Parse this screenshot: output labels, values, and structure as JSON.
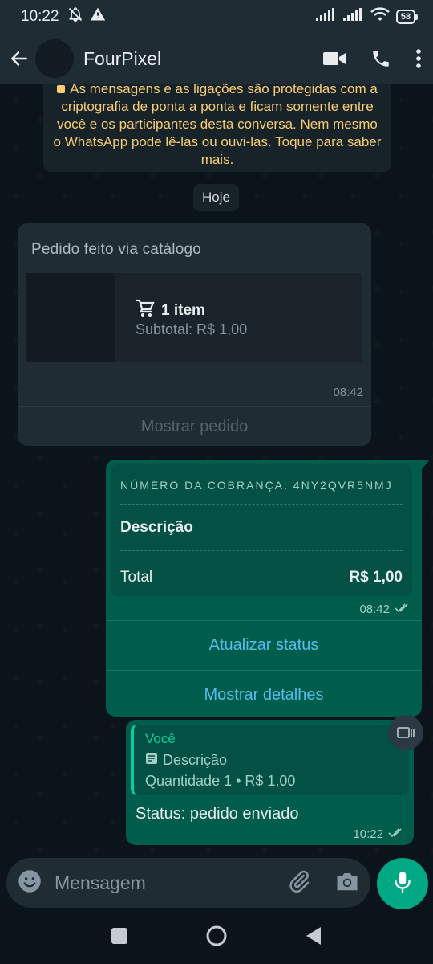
{
  "status_bar": {
    "time": "10:22",
    "battery": "58"
  },
  "header": {
    "contact_name": "FourPixel",
    "icons": [
      "back-arrow-icon",
      "video-call-icon",
      "phone-icon",
      "more-vert-icon"
    ]
  },
  "chat": {
    "encryption_notice": "As mensagens e as ligações são protegidas com a criptografia de ponta a ponta e ficam somente entre você e os participantes desta conversa. Nem mesmo o WhatsApp pode lê-las ou ouvi-las. Toque para saber mais.",
    "date_chip": "Hoje",
    "order_message": {
      "title": "Pedido feito via catálogo",
      "items": "1 item",
      "subtotal": "Subtotal: R$ 1,00",
      "time": "08:42",
      "action": "Mostrar pedido"
    },
    "payment_message": {
      "charge_number": "NÚMERO DA COBRANÇA: 4NY2QVR5NMJ",
      "description": "Descrição",
      "total_label": "Total",
      "total_value": "R$ 1,00",
      "time": "08:42",
      "action_update": "Atualizar status",
      "action_details": "Mostrar detalhes"
    },
    "status_message": {
      "quote_author": "Você",
      "quote_description": "Descrição",
      "quote_quantity": "Quantidade 1 • R$ 1,00",
      "text": "Status: pedido enviado",
      "time": "10:22"
    }
  },
  "composer": {
    "placeholder": "Mensagem"
  },
  "colors": {
    "accent": "#00a884",
    "outgoing_bubble": "#005c4b",
    "link": "#53bdeb",
    "notice_text": "#f7cd73"
  }
}
